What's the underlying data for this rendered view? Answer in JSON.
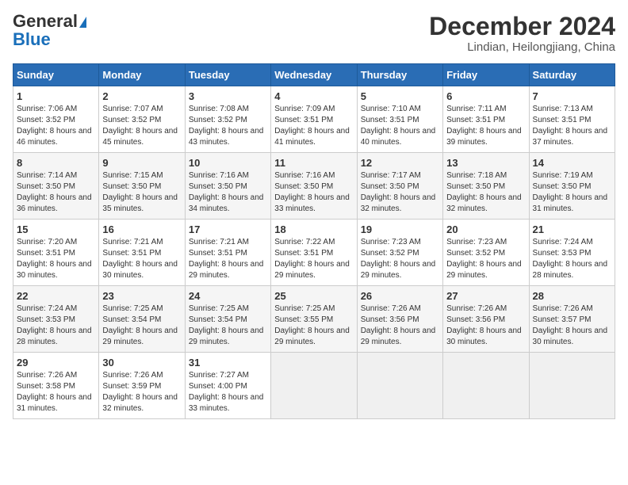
{
  "logo": {
    "general": "General",
    "blue": "Blue"
  },
  "title": "December 2024",
  "subtitle": "Lindian, Heilongjiang, China",
  "days_of_week": [
    "Sunday",
    "Monday",
    "Tuesday",
    "Wednesday",
    "Thursday",
    "Friday",
    "Saturday"
  ],
  "weeks": [
    [
      {
        "day": "1",
        "sunrise": "7:06 AM",
        "sunset": "3:52 PM",
        "daylight": "8 hours and 46 minutes."
      },
      {
        "day": "2",
        "sunrise": "7:07 AM",
        "sunset": "3:52 PM",
        "daylight": "8 hours and 45 minutes."
      },
      {
        "day": "3",
        "sunrise": "7:08 AM",
        "sunset": "3:52 PM",
        "daylight": "8 hours and 43 minutes."
      },
      {
        "day": "4",
        "sunrise": "7:09 AM",
        "sunset": "3:51 PM",
        "daylight": "8 hours and 41 minutes."
      },
      {
        "day": "5",
        "sunrise": "7:10 AM",
        "sunset": "3:51 PM",
        "daylight": "8 hours and 40 minutes."
      },
      {
        "day": "6",
        "sunrise": "7:11 AM",
        "sunset": "3:51 PM",
        "daylight": "8 hours and 39 minutes."
      },
      {
        "day": "7",
        "sunrise": "7:13 AM",
        "sunset": "3:51 PM",
        "daylight": "8 hours and 37 minutes."
      }
    ],
    [
      {
        "day": "8",
        "sunrise": "7:14 AM",
        "sunset": "3:50 PM",
        "daylight": "8 hours and 36 minutes."
      },
      {
        "day": "9",
        "sunrise": "7:15 AM",
        "sunset": "3:50 PM",
        "daylight": "8 hours and 35 minutes."
      },
      {
        "day": "10",
        "sunrise": "7:16 AM",
        "sunset": "3:50 PM",
        "daylight": "8 hours and 34 minutes."
      },
      {
        "day": "11",
        "sunrise": "7:16 AM",
        "sunset": "3:50 PM",
        "daylight": "8 hours and 33 minutes."
      },
      {
        "day": "12",
        "sunrise": "7:17 AM",
        "sunset": "3:50 PM",
        "daylight": "8 hours and 32 minutes."
      },
      {
        "day": "13",
        "sunrise": "7:18 AM",
        "sunset": "3:50 PM",
        "daylight": "8 hours and 32 minutes."
      },
      {
        "day": "14",
        "sunrise": "7:19 AM",
        "sunset": "3:50 PM",
        "daylight": "8 hours and 31 minutes."
      }
    ],
    [
      {
        "day": "15",
        "sunrise": "7:20 AM",
        "sunset": "3:51 PM",
        "daylight": "8 hours and 30 minutes."
      },
      {
        "day": "16",
        "sunrise": "7:21 AM",
        "sunset": "3:51 PM",
        "daylight": "8 hours and 30 minutes."
      },
      {
        "day": "17",
        "sunrise": "7:21 AM",
        "sunset": "3:51 PM",
        "daylight": "8 hours and 29 minutes."
      },
      {
        "day": "18",
        "sunrise": "7:22 AM",
        "sunset": "3:51 PM",
        "daylight": "8 hours and 29 minutes."
      },
      {
        "day": "19",
        "sunrise": "7:23 AM",
        "sunset": "3:52 PM",
        "daylight": "8 hours and 29 minutes."
      },
      {
        "day": "20",
        "sunrise": "7:23 AM",
        "sunset": "3:52 PM",
        "daylight": "8 hours and 29 minutes."
      },
      {
        "day": "21",
        "sunrise": "7:24 AM",
        "sunset": "3:53 PM",
        "daylight": "8 hours and 28 minutes."
      }
    ],
    [
      {
        "day": "22",
        "sunrise": "7:24 AM",
        "sunset": "3:53 PM",
        "daylight": "8 hours and 28 minutes."
      },
      {
        "day": "23",
        "sunrise": "7:25 AM",
        "sunset": "3:54 PM",
        "daylight": "8 hours and 29 minutes."
      },
      {
        "day": "24",
        "sunrise": "7:25 AM",
        "sunset": "3:54 PM",
        "daylight": "8 hours and 29 minutes."
      },
      {
        "day": "25",
        "sunrise": "7:25 AM",
        "sunset": "3:55 PM",
        "daylight": "8 hours and 29 minutes."
      },
      {
        "day": "26",
        "sunrise": "7:26 AM",
        "sunset": "3:56 PM",
        "daylight": "8 hours and 29 minutes."
      },
      {
        "day": "27",
        "sunrise": "7:26 AM",
        "sunset": "3:56 PM",
        "daylight": "8 hours and 30 minutes."
      },
      {
        "day": "28",
        "sunrise": "7:26 AM",
        "sunset": "3:57 PM",
        "daylight": "8 hours and 30 minutes."
      }
    ],
    [
      {
        "day": "29",
        "sunrise": "7:26 AM",
        "sunset": "3:58 PM",
        "daylight": "8 hours and 31 minutes."
      },
      {
        "day": "30",
        "sunrise": "7:26 AM",
        "sunset": "3:59 PM",
        "daylight": "8 hours and 32 minutes."
      },
      {
        "day": "31",
        "sunrise": "7:27 AM",
        "sunset": "4:00 PM",
        "daylight": "8 hours and 33 minutes."
      },
      null,
      null,
      null,
      null
    ]
  ],
  "labels": {
    "sunrise": "Sunrise:",
    "sunset": "Sunset:",
    "daylight": "Daylight:"
  }
}
